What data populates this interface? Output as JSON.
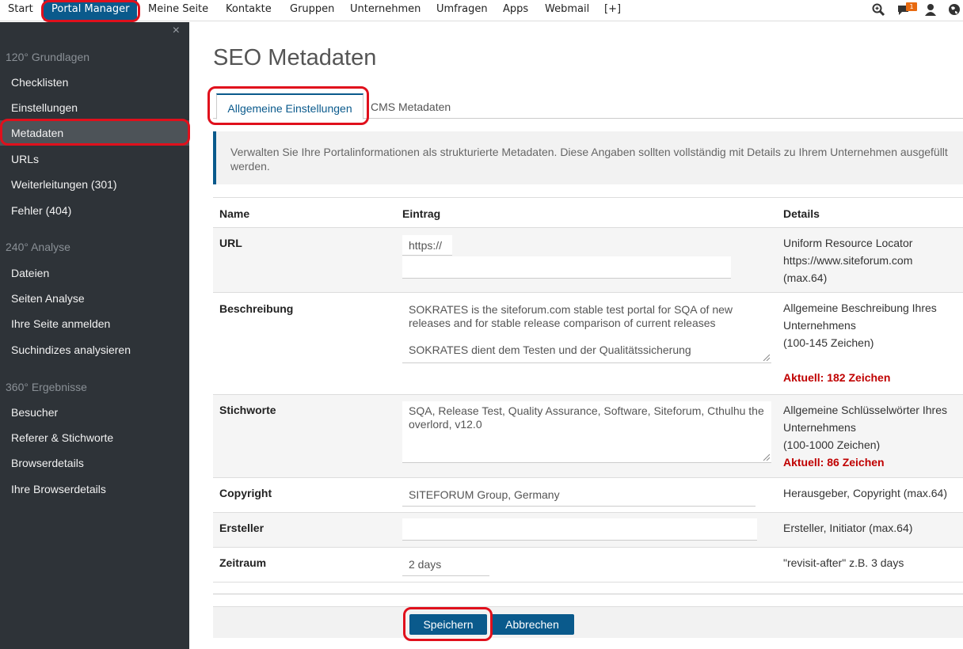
{
  "topnav": {
    "items": [
      "Start",
      "Portal Manager",
      "Meine Seite",
      "Kontakte",
      "Gruppen",
      "Unternehmen",
      "Umfragen",
      "Apps",
      "Webmail",
      "[+]"
    ],
    "notification_count": "1"
  },
  "sidebar": {
    "close_glyph": "×",
    "sections": [
      {
        "title": "120° Grundlagen",
        "items": [
          "Checklisten",
          "Einstellungen",
          "Metadaten",
          "URLs",
          "Weiterleitungen (301)",
          "Fehler (404)"
        ]
      },
      {
        "title": "240° Analyse",
        "items": [
          "Dateien",
          "Seiten Analyse",
          "Ihre Seite anmelden",
          "Suchindizes analysieren"
        ]
      },
      {
        "title": "360° Ergebnisse",
        "items": [
          "Besucher",
          "Referer & Stichworte",
          "Browserdetails",
          "Ihre Browserdetails"
        ]
      }
    ],
    "active_item": "Metadaten"
  },
  "page": {
    "title": "SEO Metadaten",
    "tabs": [
      "Allgemeine Einstellungen",
      "CMS Metadaten"
    ],
    "info": "Verwalten Sie Ihre Portalinformationen als strukturierte Metadaten. Diese Angaben sollten vollständig mit Details zu Ihrem Unternehmen ausgefüllt werden."
  },
  "table": {
    "headers": {
      "name": "Name",
      "entry": "Eintrag",
      "details": "Details"
    },
    "rows": {
      "url": {
        "name": "URL",
        "prefix": "https://",
        "value": "",
        "details": [
          "Uniform Resource Locator",
          "https://www.siteforum.com",
          "(max.64)"
        ]
      },
      "beschreibung": {
        "name": "Beschreibung",
        "value_line1": "SOKRATES is the siteforum.com stable test portal for SQA of new releases and for stable release comparison of current releases",
        "value_line2": "SOKRATES dient dem Testen und der Qualitätssicherung",
        "details": [
          "Allgemeine Beschreibung Ihres Unternehmens",
          "(100-145 Zeichen)"
        ],
        "warning": "Aktuell: 182 Zeichen"
      },
      "stichworte": {
        "name": "Stichworte",
        "value": "SQA, Release Test, Quality Assurance, Software, Siteforum, Cthulhu the overlord, v12.0",
        "details": [
          "Allgemeine Schlüsselwörter Ihres Unternehmens",
          "(100-1000 Zeichen)"
        ],
        "warning": "Aktuell: 86 Zeichen"
      },
      "copyright": {
        "name": "Copyright",
        "value": "SITEFORUM Group, Germany",
        "details": "Herausgeber, Copyright (max.64)"
      },
      "ersteller": {
        "name": "Ersteller",
        "value": "",
        "details": "Ersteller, Initiator (max.64)"
      },
      "zeitraum": {
        "name": "Zeitraum",
        "value": "2 days",
        "details": "\"revisit-after\" z.B. 3 days"
      }
    }
  },
  "buttons": {
    "save": "Speichern",
    "cancel": "Abbrechen"
  },
  "colors": {
    "accent": "#0a5a8c",
    "sidebar_bg": "#2e3338",
    "warning": "#c00000",
    "annotation": "#e0101c"
  }
}
